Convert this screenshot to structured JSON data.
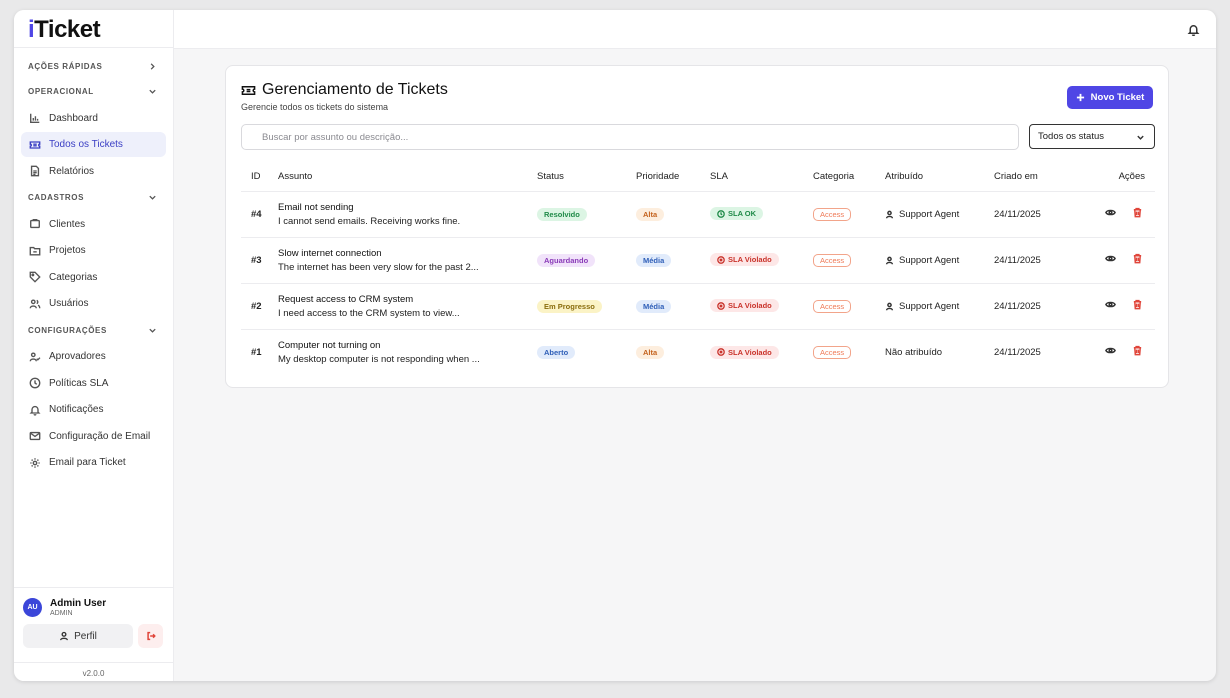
{
  "app": {
    "logo_first": "i",
    "logo_rest": "Ticket"
  },
  "sidebar": {
    "quick_actions": "AÇÕES RÁPIDAS",
    "sections": [
      {
        "label": "OPERACIONAL",
        "items": [
          "Dashboard",
          "Todos os Tickets",
          "Relatórios"
        ]
      },
      {
        "label": "CADASTROS",
        "items": [
          "Clientes",
          "Projetos",
          "Categorias",
          "Usuários"
        ]
      },
      {
        "label": "CONFIGURAÇÕES",
        "items": [
          "Aprovadores",
          "Políticas SLA",
          "Notificações",
          "Configuração de Email",
          "Email para Ticket"
        ]
      }
    ],
    "active_item": "Todos os Tickets",
    "user": {
      "initials": "AU",
      "name": "Admin User",
      "role": "ADMIN"
    },
    "profile_label": "Perfil",
    "version": "v2.0.0"
  },
  "page": {
    "title": "Gerenciamento de Tickets",
    "subtitle": "Gerencie todos os tickets do sistema",
    "new_button": "Novo Ticket",
    "search_placeholder": "Buscar por assunto ou descrição...",
    "status_filter": "Todos os status"
  },
  "table": {
    "headers": [
      "ID",
      "Assunto",
      "Status",
      "Prioridade",
      "SLA",
      "Categoria",
      "Atribuído",
      "Criado em",
      "Ações"
    ],
    "rows": [
      {
        "id": "#4",
        "title": "Email not sending",
        "desc": "I cannot send emails. Receiving works fine.",
        "status": "Resolvido",
        "priority": "Alta",
        "sla": "SLA OK",
        "category": "Access",
        "assigned": "Support Agent",
        "created": "24/11/2025"
      },
      {
        "id": "#3",
        "title": "Slow internet connection",
        "desc": "The internet has been very slow for the past 2...",
        "status": "Aguardando",
        "priority": "Média",
        "sla": "SLA Violado",
        "category": "Access",
        "assigned": "Support Agent",
        "created": "24/11/2025"
      },
      {
        "id": "#2",
        "title": "Request access to CRM system",
        "desc": "I need access to the CRM system to view...",
        "status": "Em Progresso",
        "priority": "Média",
        "sla": "SLA Violado",
        "category": "Access",
        "assigned": "Support Agent",
        "created": "24/11/2025"
      },
      {
        "id": "#1",
        "title": "Computer not turning on",
        "desc": "My desktop computer is not responding when ...",
        "status": "Aberto",
        "priority": "Alta",
        "sla": "SLA Violado",
        "category": "Access",
        "assigned": "Não atribuído",
        "created": "24/11/2025"
      }
    ]
  },
  "colors": {
    "accent": "#4f46e5",
    "status": {
      "Resolvido": {
        "bg": "#dcf5e4",
        "fg": "#1f8a48"
      },
      "Aguardando": {
        "bg": "#f1e3fa",
        "fg": "#8a3bb8"
      },
      "Em Progresso": {
        "bg": "#fbf3c6",
        "fg": "#8a6d0d"
      },
      "Aberto": {
        "bg": "#e1ebfb",
        "fg": "#2f5fb8"
      }
    },
    "priority": {
      "Alta": {
        "bg": "#fdeede",
        "fg": "#c4621d"
      },
      "Média": {
        "bg": "#e1ebfb",
        "fg": "#2f5fb8"
      }
    },
    "sla": {
      "SLA OK": {
        "bg": "#dcf5e4",
        "fg": "#1f8a48"
      },
      "SLA Violado": {
        "bg": "#fde7e7",
        "fg": "#c9332b"
      }
    }
  }
}
